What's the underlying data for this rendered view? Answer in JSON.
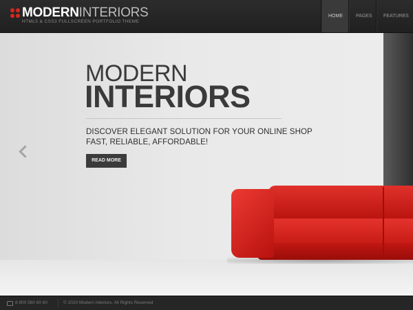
{
  "header": {
    "logo_bold": "MODERN",
    "logo_light": "INTERIORS",
    "tagline": "HTML5 & CSS3 FULLSCREEN PORTFOLIO THEME",
    "nav": [
      {
        "label": "HOME",
        "active": true
      },
      {
        "label": "PAGES",
        "active": false
      },
      {
        "label": "FEATURES",
        "active": false
      }
    ]
  },
  "hero": {
    "title_light": "MODERN",
    "title_bold": "INTERIORS",
    "description_line1": "DISCOVER ELEGANT SOLUTION FOR YOUR ONLINE SHOP",
    "description_line2": "FAST, RELIABLE, AFFORDABLE!",
    "cta_label": "READ MORE",
    "prev_arrow_icon": "chevron-left-icon"
  },
  "footer": {
    "phone_icon": "phone-icon",
    "phone": "8 800 560 60 60",
    "copyright": "© 2020 Modern Interiors. All Rights Reserved"
  },
  "colors": {
    "accent": "#d9261c",
    "header_bg": "#2c2c2c",
    "button_bg": "#3b3b3b",
    "sofa": "#d42a22"
  }
}
